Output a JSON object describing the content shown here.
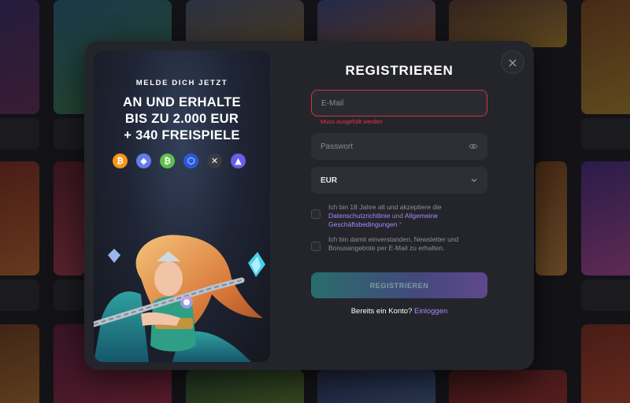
{
  "modal": {
    "title": "REGISTRIEREN",
    "close_label": "×"
  },
  "promo": {
    "small_heading": "MELDE DICH JETZT",
    "big_line1": "AN UND ERHALTE",
    "big_line2": "BIS ZU 2.000 EUR",
    "big_line3": "+ 340 FREISPIELE",
    "coins": [
      {
        "name": "bitcoin-icon",
        "glyph": "₿",
        "color": "#f7931a"
      },
      {
        "name": "ethereum-icon",
        "glyph": "◆",
        "color": "#627eea"
      },
      {
        "name": "bitcoin-cash-icon",
        "glyph": "₿",
        "color": "#5fbf4a"
      },
      {
        "name": "chainlink-icon",
        "glyph": "⬡",
        "color": "#2a5ada"
      },
      {
        "name": "xrp-icon",
        "glyph": "✕",
        "color": "#3a3b42"
      },
      {
        "name": "tron-icon",
        "glyph": "▲",
        "color": "#6c5ce7"
      }
    ]
  },
  "form": {
    "email_placeholder": "E-Mail",
    "email_error": "Muss ausgefüllt werden",
    "password_placeholder": "Passwort",
    "currency_value": "EUR",
    "terms_pre": "Ich bin 18 Jahre alt und akzeptiere die",
    "terms_link1": "Datenschutzrichtlinie",
    "terms_and": "und",
    "terms_link2": "Allgemeine Geschäftsbedingungen",
    "terms_required": "*",
    "newsletter_text": "Ich bin damit einverstanden, Newsletter und Bonusangebote per E-Mail zu erhalten.",
    "submit_label": "REGISTRIEREN",
    "login_prompt": "Bereits ein Konto?",
    "login_link": "Einloggen"
  },
  "colors": {
    "error": "#e0393f",
    "link": "#a48bff",
    "modal_bg": "#24252b"
  }
}
